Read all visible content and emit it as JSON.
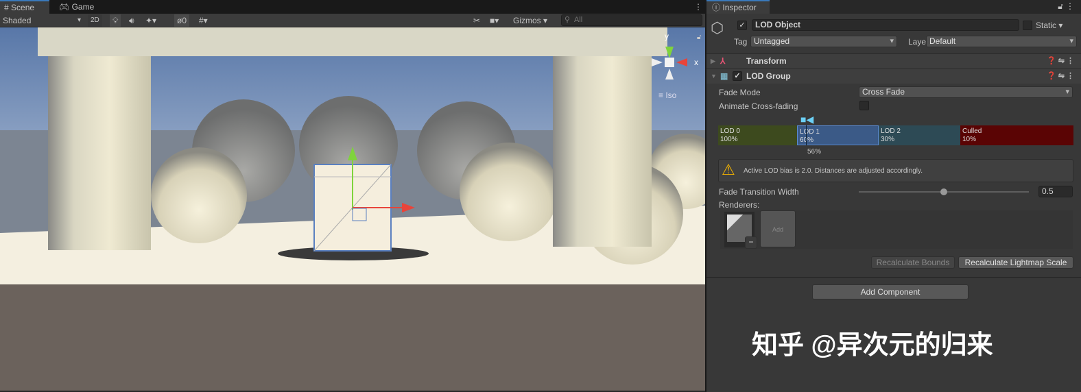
{
  "scene_tabs": [
    {
      "label": "Scene",
      "icon": "hash-icon"
    },
    {
      "label": "Game",
      "icon": "gamepad-icon"
    }
  ],
  "toolbar": {
    "shading": "Shaded",
    "mode_2d": "2D",
    "hidden_count": "0",
    "gizmos": "Gizmos",
    "search_placeholder": "All"
  },
  "gizmo": {
    "y": "y",
    "x": "x",
    "projection": "Iso"
  },
  "inspector": {
    "tab": "Inspector",
    "object_name": "LOD Object",
    "static_label": "Static",
    "tag_label": "Tag",
    "tag_value": "Untagged",
    "layer_label": "Layer",
    "layer_value": "Default",
    "components": [
      {
        "name": "Transform"
      },
      {
        "name": "LOD Group"
      }
    ],
    "fade_mode_label": "Fade Mode",
    "fade_mode_value": "Cross Fade",
    "animate_label": "Animate Cross-fading",
    "lods": [
      {
        "name": "LOD 0",
        "pct": "100%",
        "color": "#3d4a1e"
      },
      {
        "name": "LOD 1",
        "pct": "60%",
        "color": "#3b5a87"
      },
      {
        "name": "LOD 2",
        "pct": "30%",
        "color": "#2d4a55"
      },
      {
        "name": "Culled",
        "pct": "10%",
        "color": "#5a0404"
      }
    ],
    "camera_pct": "56%",
    "warning": "Active LOD bias is 2.0. Distances are adjusted accordingly.",
    "fade_width_label": "Fade Transition Width",
    "fade_width_value": "0.5",
    "fade_width_fraction": 0.5,
    "renderers_label": "Renderers:",
    "add_label": "Add",
    "recalc_bounds": "Recalculate Bounds",
    "recalc_lightmap": "Recalculate Lightmap Scale",
    "add_component": "Add Component"
  },
  "watermark": "知乎 @异次元的归来"
}
